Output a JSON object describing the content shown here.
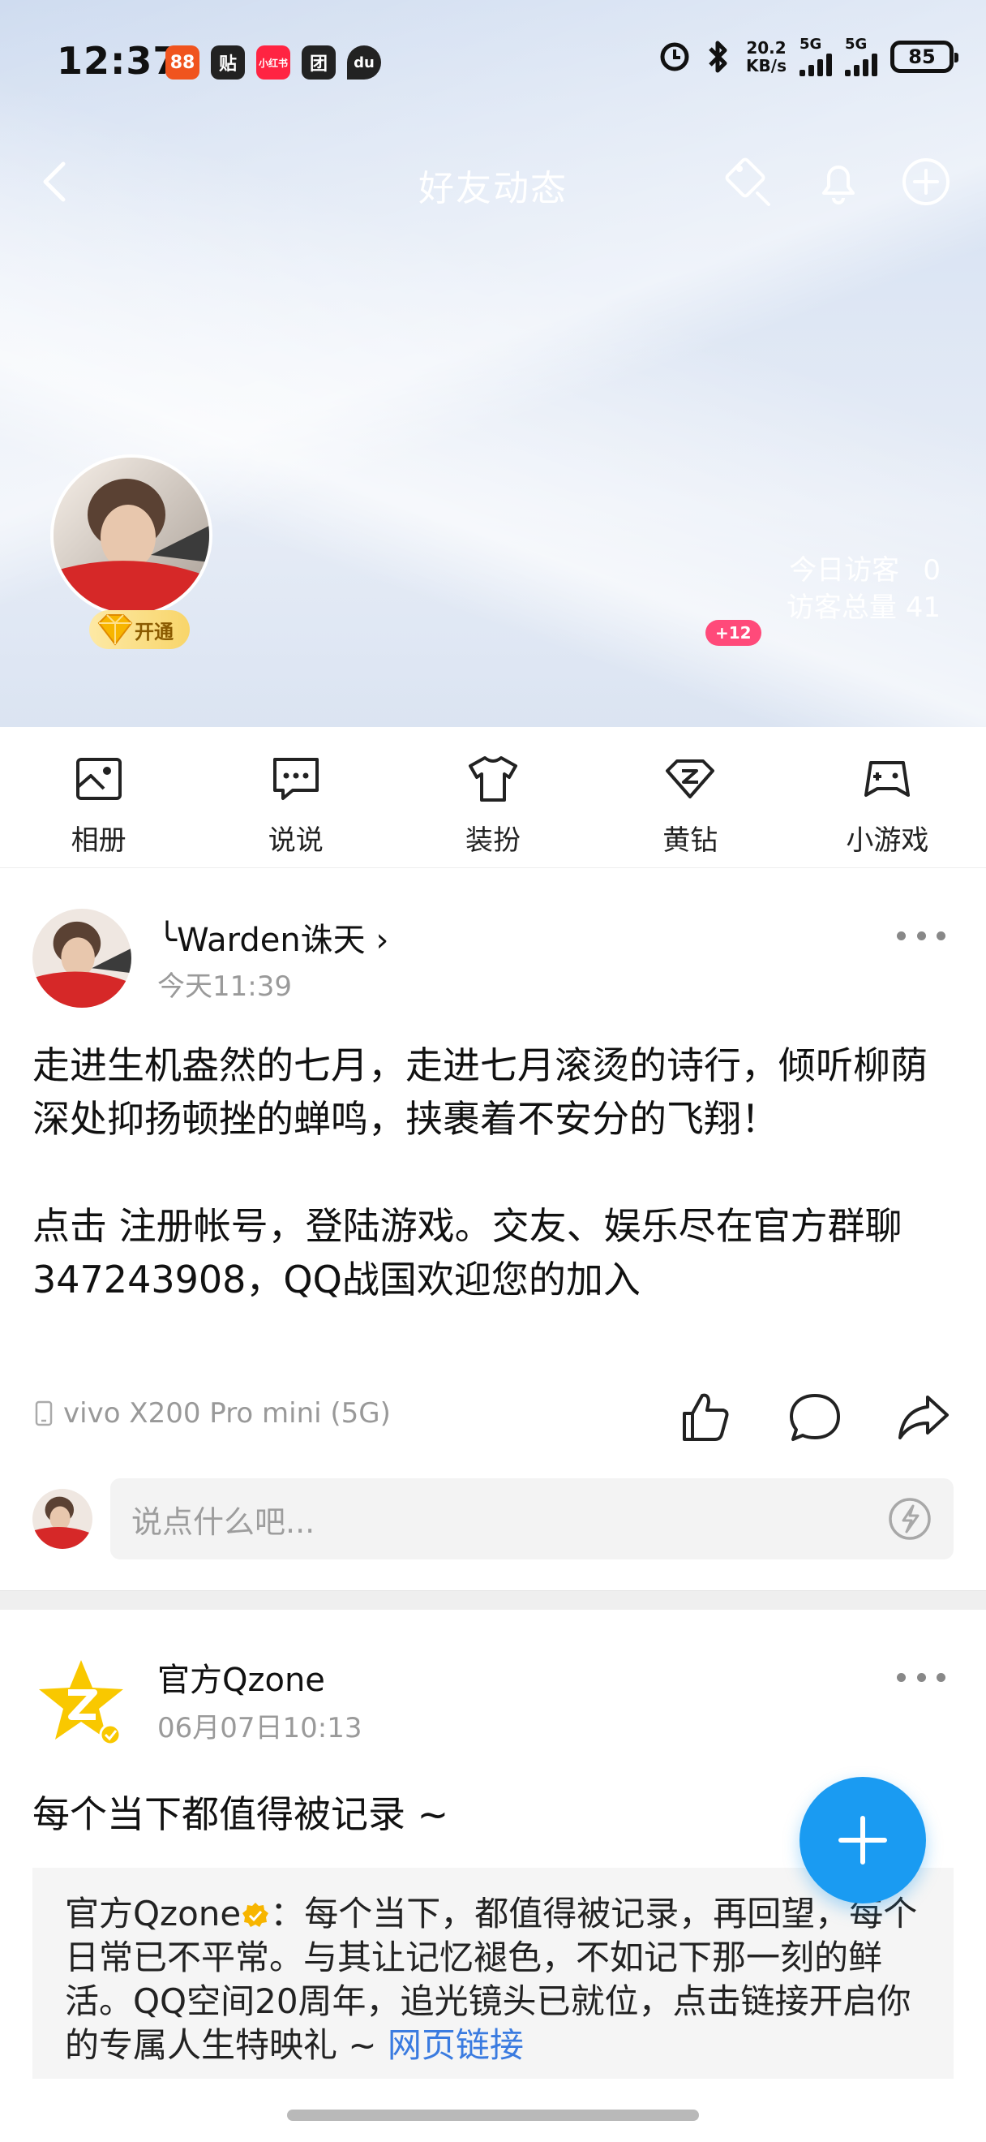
{
  "status_bar": {
    "time": "12:37",
    "app_badges": [
      {
        "label": "88",
        "color": "#f0541e"
      },
      {
        "label": "贴",
        "color": "#222222"
      },
      {
        "label": "小红书",
        "color": "#ff2442"
      },
      {
        "label": "团",
        "color": "#222222"
      },
      {
        "label": "du",
        "color": "#222222"
      }
    ],
    "net_speed_value": "20.2",
    "net_speed_unit": "KB/s",
    "signal_1": "5G",
    "signal_2": "5G",
    "battery": "85"
  },
  "nav": {
    "title": "好友动态"
  },
  "profile": {
    "vip_label": "开通",
    "visitors_today_label": "今日访客",
    "visitors_today_value": "0",
    "visitors_total_label": "访客总量",
    "visitors_total_value": "41",
    "new_badge": "+12"
  },
  "quick_menu": [
    {
      "label": "相册",
      "icon": "album-icon"
    },
    {
      "label": "说说",
      "icon": "chat-icon"
    },
    {
      "label": "装扮",
      "icon": "shirt-icon"
    },
    {
      "label": "黄钻",
      "icon": "diamond-icon"
    },
    {
      "label": "小游戏",
      "icon": "gamepad-icon"
    }
  ],
  "posts": [
    {
      "author": "╰Warden诛天 ›",
      "time": "今天11:39",
      "body": "走进生机盎然的七月，走进七月滚烫的诗行，倾听柳荫深处抑扬顿挫的蝉鸣，挟裹着不安分的飞翔！\n\n点击 注册帐号，登陆游戏。交友、娱乐尽在官方群聊347243908，QQ战国欢迎您的加入",
      "device": "vivo X200 Pro mini (5G)",
      "comment_placeholder": "说点什么吧..."
    },
    {
      "author": "官方Qzone",
      "time": "06月07日10:13",
      "body": "每个当下都值得被记录 ~",
      "repost_source": "官方Qzone",
      "repost_text": "：每个当下，都值得被记录，再回望，每个日常已不平常。与其让记忆褪色，不如记下那一刻的鲜活。QQ空间20周年，追光镜头已就位，点击链接开启你的专属人生特映礼 ~ ",
      "repost_link": "网页链接"
    }
  ],
  "colors": {
    "accent": "#1a9bf2",
    "link": "#3a7be0",
    "badge_pink": "#ff4a7a"
  }
}
